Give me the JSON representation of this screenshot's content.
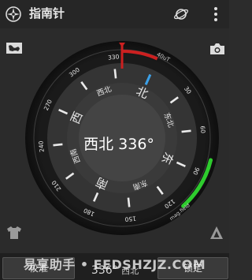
{
  "app": {
    "title": "指南针",
    "icons": {
      "app": "compass-app-icon",
      "planet": "planet-icon",
      "overflow": "overflow-menu-icon",
      "map": "map-icon",
      "camera": "camera-icon",
      "shirt": "shirt-icon",
      "level": "level-icon"
    }
  },
  "compass": {
    "heading_deg": 336,
    "direction": "西北",
    "heading_text": "336°",
    "cardinals": [
      "北",
      "东",
      "南",
      "西"
    ],
    "intercardinals": [
      "东北",
      "东南",
      "西南",
      "西北"
    ],
    "degree_labels": [
      "30",
      "60",
      "90",
      "120",
      "150",
      "180",
      "210",
      "240",
      "270",
      "300",
      "330"
    ],
    "magnetic_field_label": "40uT",
    "mag_field_arc_label": "mag.field",
    "colors": {
      "north_marker": "#cc2020",
      "north_label": "#3aa0e8",
      "mag_field": "#2ecc2e",
      "bezel": "#1d1d1d",
      "dial": "#3c3c3c"
    }
  },
  "bottom": {
    "calibrate_label": "校准",
    "lock_label": "锁定",
    "heading_text": "336°",
    "direction": "西北"
  },
  "watermark": "易享助手 • EEDSHZJZ.COM"
}
